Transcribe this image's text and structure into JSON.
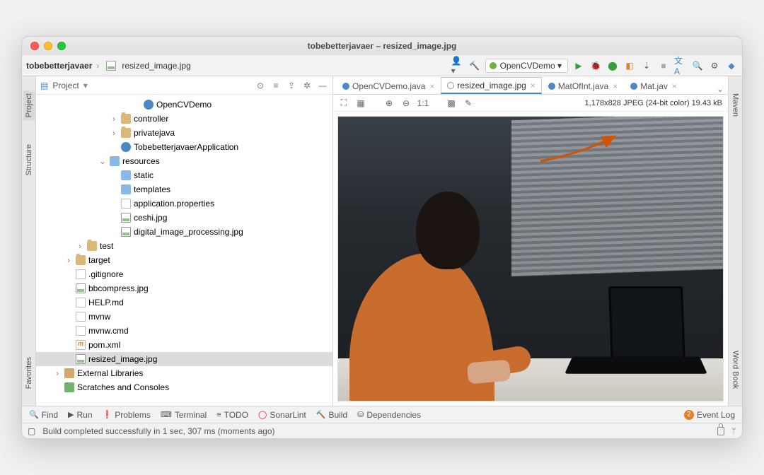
{
  "window_title": "tobebetterjavaer – resized_image.jpg",
  "breadcrumb": {
    "root": "tobebetterjavaer",
    "file": "resized_image.jpg"
  },
  "run_config": "OpenCVDemo",
  "left_tabs": {
    "project": "Project",
    "structure": "Structure",
    "favorites": "Favorites"
  },
  "right_tabs": {
    "maven": "Maven",
    "wordbook": "Word Book"
  },
  "project_panel": {
    "title": "Project",
    "tree": [
      {
        "indent": 8,
        "twisty": "",
        "icon": "class",
        "label": "OpenCVDemo"
      },
      {
        "indent": 6,
        "twisty": ">",
        "icon": "folder",
        "label": "controller"
      },
      {
        "indent": 6,
        "twisty": ">",
        "icon": "folder",
        "label": "privatejava"
      },
      {
        "indent": 6,
        "twisty": "",
        "icon": "class",
        "label": "TobebetterjavaerApplication"
      },
      {
        "indent": 5,
        "twisty": "v",
        "icon": "folder-res",
        "label": "resources"
      },
      {
        "indent": 6,
        "twisty": "",
        "icon": "folder-res",
        "label": "static"
      },
      {
        "indent": 6,
        "twisty": "",
        "icon": "folder-res",
        "label": "templates"
      },
      {
        "indent": 6,
        "twisty": "",
        "icon": "file",
        "label": "application.properties"
      },
      {
        "indent": 6,
        "twisty": "",
        "icon": "img",
        "label": "ceshi.jpg"
      },
      {
        "indent": 6,
        "twisty": "",
        "icon": "img",
        "label": "digital_image_processing.jpg"
      },
      {
        "indent": 3,
        "twisty": ">",
        "icon": "folder",
        "label": "test"
      },
      {
        "indent": 2,
        "twisty": ">",
        "icon": "folder",
        "label": "target"
      },
      {
        "indent": 2,
        "twisty": "",
        "icon": "file",
        "label": ".gitignore"
      },
      {
        "indent": 2,
        "twisty": "",
        "icon": "img",
        "label": "bbcompress.jpg"
      },
      {
        "indent": 2,
        "twisty": "",
        "icon": "file",
        "label": "HELP.md"
      },
      {
        "indent": 2,
        "twisty": "",
        "icon": "file",
        "label": "mvnw"
      },
      {
        "indent": 2,
        "twisty": "",
        "icon": "file",
        "label": "mvnw.cmd"
      },
      {
        "indent": 2,
        "twisty": "",
        "icon": "xml",
        "label": "pom.xml"
      },
      {
        "indent": 2,
        "twisty": "",
        "icon": "img",
        "label": "resized_image.jpg",
        "selected": true
      },
      {
        "indent": 1,
        "twisty": ">",
        "icon": "lib",
        "label": "External Libraries"
      },
      {
        "indent": 1,
        "twisty": "",
        "icon": "scratch",
        "label": "Scratches and Consoles"
      }
    ]
  },
  "editor_tabs": [
    {
      "label": "OpenCVDemo.java",
      "kind": "java",
      "active": false
    },
    {
      "label": "resized_image.jpg",
      "kind": "jpg",
      "active": true
    },
    {
      "label": "MatOfInt.java",
      "kind": "java",
      "active": false
    },
    {
      "label": "Mat.jav",
      "kind": "java",
      "active": false
    }
  ],
  "image_info": "1,178x828 JPEG (24-bit color) 19.43 kB",
  "bottom_tools": {
    "find": "Find",
    "run": "Run",
    "problems": "Problems",
    "terminal": "Terminal",
    "todo": "TODO",
    "sonar": "SonarLint",
    "build": "Build",
    "deps": "Dependencies",
    "eventlog": "Event Log"
  },
  "status": "Build completed successfully in 1 sec, 307 ms (moments ago)"
}
